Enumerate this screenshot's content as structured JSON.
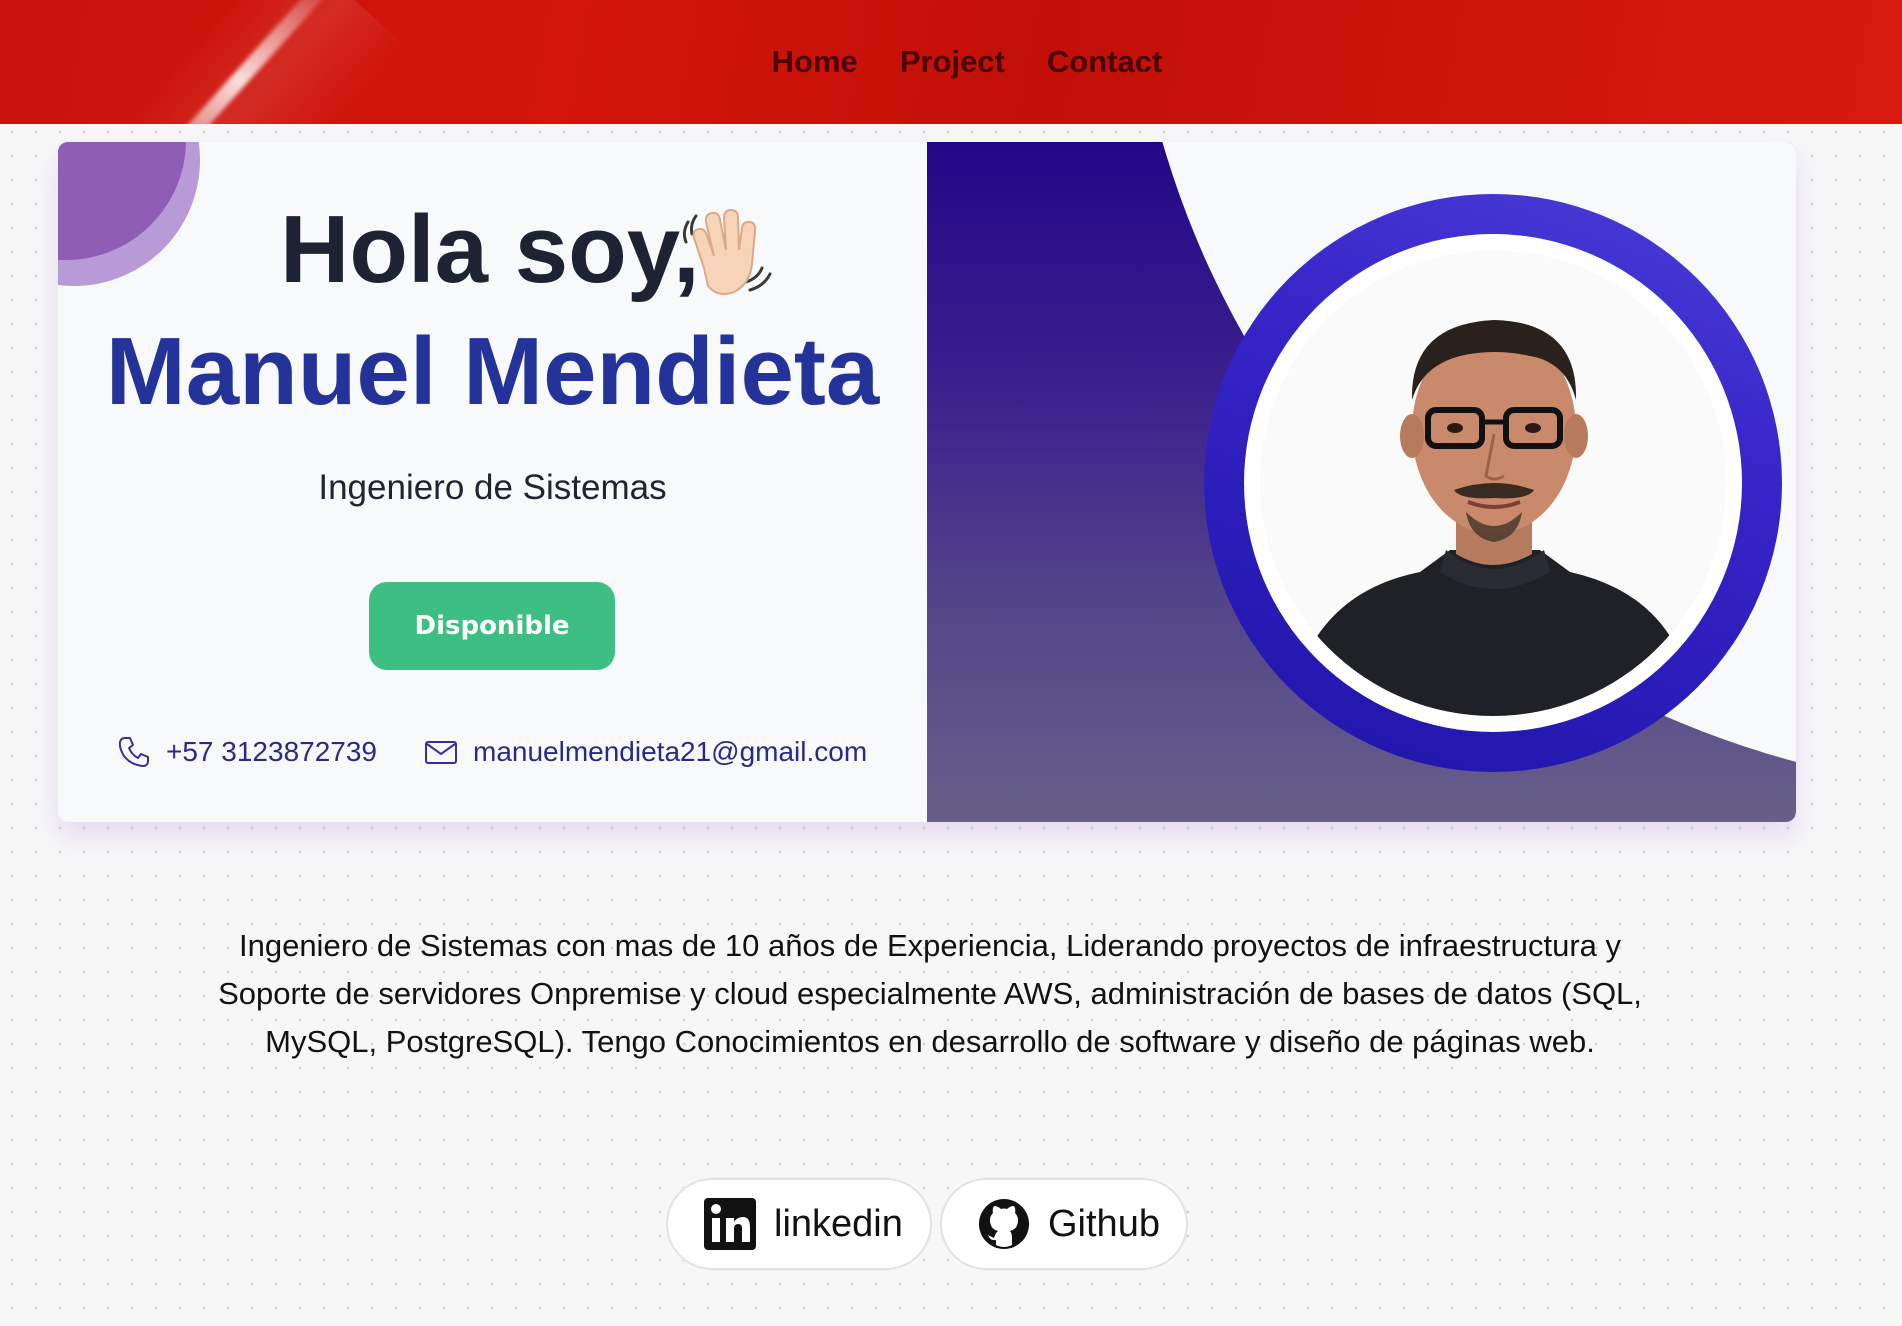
{
  "nav": {
    "items": [
      {
        "label": "Home"
      },
      {
        "label": "Project"
      },
      {
        "label": "Contact"
      }
    ]
  },
  "hero": {
    "greeting": "Hola soy,",
    "wave_icon": "waving-hand-icon",
    "name": "Manuel Mendieta",
    "role": "Ingeniero de Sistemas",
    "status_button": "Disponible",
    "phone": "+57 3123872739",
    "email": "manuelmendieta21@gmail.com"
  },
  "about": {
    "text": "Ingeniero de Sistemas con mas de 10 años de Experiencia, Liderando proyectos de infraestructura y Soporte de servidores Onpremise y cloud especialmente AWS, administración de bases de datos (SQL, MySQL, PostgreSQL). Tengo Conocimientos en desarrollo de software y diseño de páginas web."
  },
  "social": {
    "linkedin_label": "linkedin",
    "github_label": "Github"
  },
  "colors": {
    "nav_red": "#c9130c",
    "name_blue": "#24339a",
    "button_green": "#3dbf84",
    "panel_purple": "#220787"
  }
}
